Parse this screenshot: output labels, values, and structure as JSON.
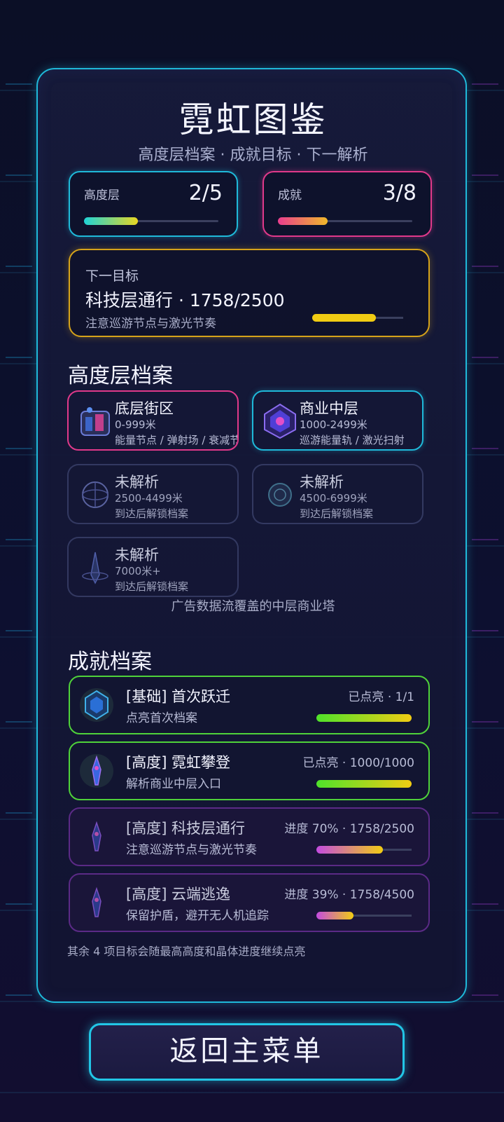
{
  "title": "霓虹图鉴",
  "subtitle": "高度层档案 · 成就目标 · 下一解析",
  "stats": {
    "layers": {
      "label": "高度层",
      "value": "2/5",
      "progress": 0.4
    },
    "achievements": {
      "label": "成就",
      "value": "3/8",
      "progress": 0.37
    }
  },
  "next_goal": {
    "heading": "下一目标",
    "name": "科技层通行 · 1758/2500",
    "hint": "注意巡游节点与激光节奏",
    "progress": 0.703
  },
  "layers_section": {
    "heading": "高度层档案",
    "items": [
      {
        "name": "底层街区",
        "range": "0-999米",
        "desc": "能量节点 / 弹射场 / 衰减节",
        "locked": false,
        "accent": "#e0398a"
      },
      {
        "name": "商业中层",
        "range": "1000-2499米",
        "desc": "巡游能量轨 / 激光扫射",
        "locked": false,
        "accent": "#1fb9d9"
      },
      {
        "name": "未解析",
        "range": "2500-4499米",
        "desc": "到达后解锁档案",
        "locked": true
      },
      {
        "name": "未解析",
        "range": "4500-6999米",
        "desc": "到达后解锁档案",
        "locked": true
      },
      {
        "name": "未解析",
        "range": "7000米+",
        "desc": "到达后解锁档案",
        "locked": true
      }
    ],
    "caption": "广告数据流覆盖的中层商业塔"
  },
  "achievements_section": {
    "heading": "成就档案",
    "items": [
      {
        "title": "[基础] 首次跃迁",
        "desc": "点亮首次档案",
        "status": "已点亮 · 1/1",
        "progress": 1.0,
        "done": true
      },
      {
        "title": "[高度] 霓虹攀登",
        "desc": "解析商业中层入口",
        "status": "已点亮 · 1000/1000",
        "progress": 1.0,
        "done": true
      },
      {
        "title": "[高度] 科技层通行",
        "desc": "注意巡游节点与激光节奏",
        "status": "进度 70% · 1758/2500",
        "progress": 0.7,
        "done": false
      },
      {
        "title": "[高度] 云端逃逸",
        "desc": "保留护盾，避开无人机追踪",
        "status": "进度 39% · 1758/4500",
        "progress": 0.39,
        "done": false
      }
    ],
    "footnote": "其余 4 项目标会随最高高度和晶体进度继续点亮"
  },
  "main_menu_button": "返回主菜单",
  "colors": {
    "cyan": "#1fb9d9",
    "pink": "#e0398a",
    "gold": "#f1cc13",
    "green": "#4fd23a",
    "purple": "#5b2a86"
  }
}
